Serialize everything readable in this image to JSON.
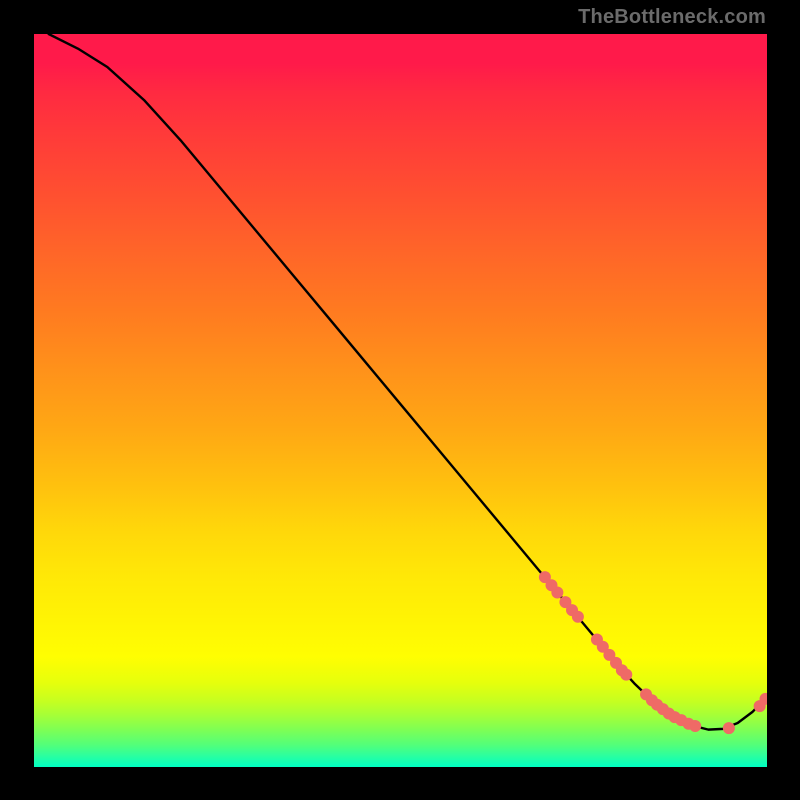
{
  "attribution": "TheBottleneck.com",
  "chart_data": {
    "type": "line",
    "title": "",
    "xlabel": "",
    "ylabel": "",
    "xlim": [
      0,
      100
    ],
    "ylim": [
      0,
      100
    ],
    "grid": false,
    "series": [
      {
        "name": "curve",
        "x": [
          2,
          6,
          10,
          15,
          20,
          25,
          30,
          35,
          40,
          45,
          50,
          55,
          60,
          65,
          70,
          72,
          74,
          76,
          78,
          80,
          82,
          84,
          86,
          88,
          90,
          92,
          94,
          96,
          98,
          100
        ],
        "y": [
          100,
          98,
          95.5,
          91,
          85.5,
          79.5,
          73.5,
          67.5,
          61.5,
          55.5,
          49.5,
          43.5,
          37.5,
          31.5,
          25.5,
          23.1,
          20.7,
          18.3,
          15.9,
          13.5,
          11.3,
          9.4,
          7.8,
          6.5,
          5.6,
          5.1,
          5.2,
          6.0,
          7.5,
          9.6
        ],
        "color": "#000000"
      }
    ],
    "markers": {
      "name": "dots",
      "color": "#ef6a66",
      "radius": 6,
      "points": [
        {
          "x": 69.7,
          "y": 25.9
        },
        {
          "x": 70.6,
          "y": 24.8
        },
        {
          "x": 71.4,
          "y": 23.8
        },
        {
          "x": 72.5,
          "y": 22.5
        },
        {
          "x": 73.4,
          "y": 21.4
        },
        {
          "x": 74.2,
          "y": 20.5
        },
        {
          "x": 76.8,
          "y": 17.4
        },
        {
          "x": 77.6,
          "y": 16.4
        },
        {
          "x": 78.5,
          "y": 15.3
        },
        {
          "x": 79.4,
          "y": 14.2
        },
        {
          "x": 80.2,
          "y": 13.2
        },
        {
          "x": 80.8,
          "y": 12.6
        },
        {
          "x": 83.5,
          "y": 9.9
        },
        {
          "x": 84.3,
          "y": 9.1
        },
        {
          "x": 85.0,
          "y": 8.5
        },
        {
          "x": 85.8,
          "y": 7.9
        },
        {
          "x": 86.6,
          "y": 7.3
        },
        {
          "x": 87.4,
          "y": 6.8
        },
        {
          "x": 88.3,
          "y": 6.4
        },
        {
          "x": 89.3,
          "y": 5.9
        },
        {
          "x": 90.2,
          "y": 5.6
        },
        {
          "x": 94.8,
          "y": 5.3
        },
        {
          "x": 99.0,
          "y": 8.3
        },
        {
          "x": 99.8,
          "y": 9.3
        }
      ]
    }
  }
}
